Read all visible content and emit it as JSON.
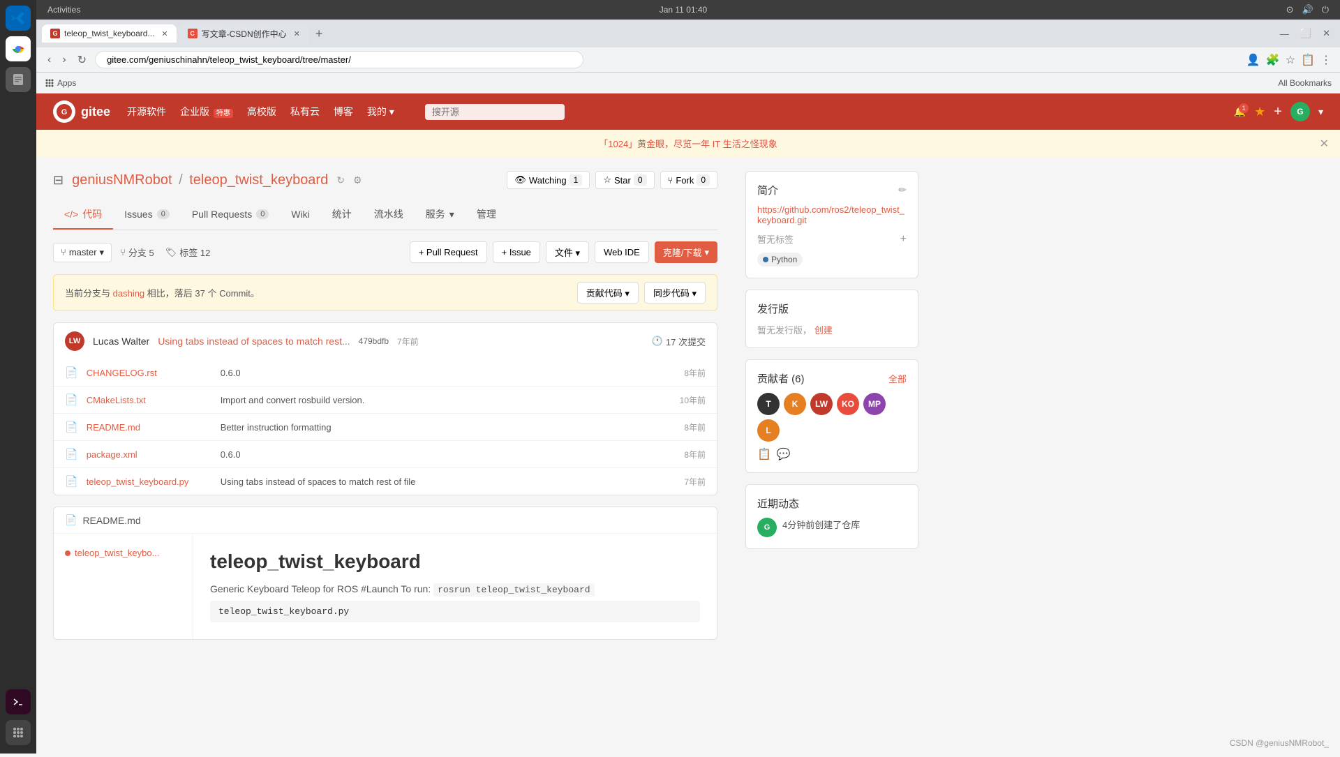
{
  "system": {
    "time": "Jan 11  01:40",
    "taskbar_title": "Activities"
  },
  "browser": {
    "tabs": [
      {
        "id": "tab1",
        "title": "teleop_twist_keyboard...",
        "favicon_color": "#c0392b",
        "active": true
      },
      {
        "id": "tab2",
        "title": "写文章-CSDN创作中心",
        "favicon_color": "#e74c3c",
        "active": false
      }
    ],
    "address": "gitee.com/geniuschinahn/teleop_twist_keyboard/tree/master/",
    "bookmarks_label": "Apps",
    "all_bookmarks": "All Bookmarks"
  },
  "gitee": {
    "logo_text": "gitee",
    "logo_letter": "G",
    "nav": [
      {
        "label": "开源软件"
      },
      {
        "label": "企业版",
        "badge": "特惠"
      },
      {
        "label": "高校版"
      },
      {
        "label": "私有云"
      },
      {
        "label": "博客"
      },
      {
        "label": "我的",
        "dropdown": true
      }
    ],
    "search_placeholder": "搜开源",
    "banner_text": "「1024」黄金眼，尽览一年 IT 生活之怪现象"
  },
  "repo": {
    "owner": "geniusNMRobot",
    "name": "teleop_twist_keyboard",
    "owner_link": "geniusNMRobot",
    "separator": "/",
    "watch_label": "Watching",
    "watch_count": "1",
    "star_label": "Star",
    "star_count": "0",
    "fork_label": "Fork",
    "fork_count": "0",
    "tabs": [
      {
        "label": "代码",
        "icon": "</>",
        "active": true
      },
      {
        "label": "Issues",
        "count": "0"
      },
      {
        "label": "Pull Requests",
        "count": "0"
      },
      {
        "label": "Wiki"
      },
      {
        "label": "统计"
      },
      {
        "label": "流水线"
      },
      {
        "label": "服务",
        "dropdown": true
      },
      {
        "label": "管理"
      }
    ],
    "branch": {
      "current": "master",
      "branches": "分支 5",
      "tags": "标签 12"
    },
    "actions": {
      "pull_request": "+ Pull Request",
      "issue": "+ Issue",
      "file": "文件",
      "web_ide": "Web IDE",
      "clone": "克隆/下载"
    },
    "diff_notice": "当前分支与 dashing 相比，落后 37 个 Commit。",
    "diff_link": "dashing",
    "diff_btn1": "贡献代码",
    "diff_btn2": "同步代码",
    "commit": {
      "author": "Lucas Walter",
      "author_initials": "LW",
      "message": "Using tabs instead of spaces to match rest...",
      "hash": "479bdfb",
      "time": "7年前",
      "count": "17 次提交"
    },
    "files": [
      {
        "name": "CHANGELOG.rst",
        "message": "0.6.0",
        "time": "8年前"
      },
      {
        "name": "CMakeLists.txt",
        "message": "Import and convert rosbuild version.",
        "time": "10年前"
      },
      {
        "name": "README.md",
        "message": "Better instruction formatting",
        "time": "8年前"
      },
      {
        "name": "package.xml",
        "message": "0.6.0",
        "time": "8年前"
      },
      {
        "name": "teleop_twist_keyboard.py",
        "message": "Using tabs instead of spaces to match rest of file",
        "time": "7年前"
      }
    ],
    "readme": {
      "title": "README.md",
      "sidebar_item": "teleop_twist_keybo...",
      "heading": "teleop_twist_keyboard",
      "desc": "Generic Keyboard Teleop for ROS #Launch To run:",
      "code_inline": "rosrun teleop_twist_keyboard",
      "code_block": "teleop_twist_keyboard.py"
    }
  },
  "sidebar": {
    "intro_title": "简介",
    "repo_url": "https://github.com/ros2/teleop_twist_keyboard.git",
    "tags_label": "暂无标签",
    "lang_label": "Python",
    "lang_color": "#3572A5",
    "release_title": "发行版",
    "no_release": "暂无发行版，",
    "create_release": "创建",
    "contributors_title": "贡献者 (6)",
    "contributors_all": "全部",
    "contributors": [
      {
        "initials": "T",
        "color": "#333"
      },
      {
        "initials": "K",
        "color": "#e67e22"
      },
      {
        "initials": "LW",
        "color": "#c0392b"
      },
      {
        "initials": "KO",
        "color": "#e74c3c"
      },
      {
        "initials": "MP",
        "color": "#8e44ad"
      },
      {
        "initials": "L",
        "color": "#e67e22"
      }
    ],
    "activity_title": "近期动态",
    "activity_item": {
      "initials": "G",
      "text": "4分钟前创建了仓库"
    }
  },
  "footer": {
    "credit": "CSDN @geniusNMRobot_"
  }
}
